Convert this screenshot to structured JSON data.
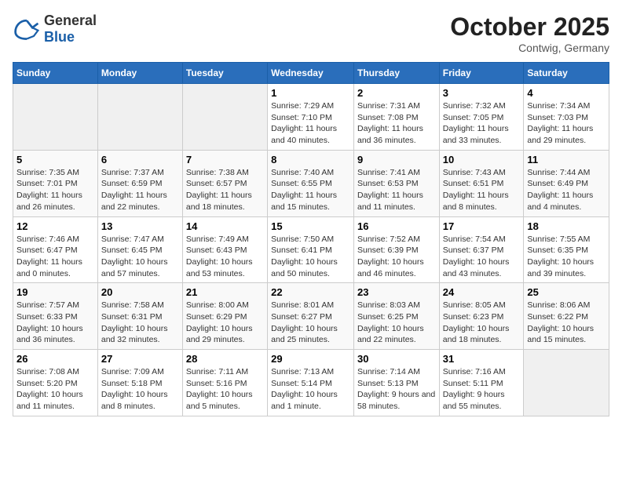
{
  "header": {
    "logo_general": "General",
    "logo_blue": "Blue",
    "month_title": "October 2025",
    "location": "Contwig, Germany"
  },
  "days_of_week": [
    "Sunday",
    "Monday",
    "Tuesday",
    "Wednesday",
    "Thursday",
    "Friday",
    "Saturday"
  ],
  "weeks": [
    [
      {
        "day": "",
        "info": ""
      },
      {
        "day": "",
        "info": ""
      },
      {
        "day": "",
        "info": ""
      },
      {
        "day": "1",
        "info": "Sunrise: 7:29 AM\nSunset: 7:10 PM\nDaylight: 11 hours and 40 minutes."
      },
      {
        "day": "2",
        "info": "Sunrise: 7:31 AM\nSunset: 7:08 PM\nDaylight: 11 hours and 36 minutes."
      },
      {
        "day": "3",
        "info": "Sunrise: 7:32 AM\nSunset: 7:05 PM\nDaylight: 11 hours and 33 minutes."
      },
      {
        "day": "4",
        "info": "Sunrise: 7:34 AM\nSunset: 7:03 PM\nDaylight: 11 hours and 29 minutes."
      }
    ],
    [
      {
        "day": "5",
        "info": "Sunrise: 7:35 AM\nSunset: 7:01 PM\nDaylight: 11 hours and 26 minutes."
      },
      {
        "day": "6",
        "info": "Sunrise: 7:37 AM\nSunset: 6:59 PM\nDaylight: 11 hours and 22 minutes."
      },
      {
        "day": "7",
        "info": "Sunrise: 7:38 AM\nSunset: 6:57 PM\nDaylight: 11 hours and 18 minutes."
      },
      {
        "day": "8",
        "info": "Sunrise: 7:40 AM\nSunset: 6:55 PM\nDaylight: 11 hours and 15 minutes."
      },
      {
        "day": "9",
        "info": "Sunrise: 7:41 AM\nSunset: 6:53 PM\nDaylight: 11 hours and 11 minutes."
      },
      {
        "day": "10",
        "info": "Sunrise: 7:43 AM\nSunset: 6:51 PM\nDaylight: 11 hours and 8 minutes."
      },
      {
        "day": "11",
        "info": "Sunrise: 7:44 AM\nSunset: 6:49 PM\nDaylight: 11 hours and 4 minutes."
      }
    ],
    [
      {
        "day": "12",
        "info": "Sunrise: 7:46 AM\nSunset: 6:47 PM\nDaylight: 11 hours and 0 minutes."
      },
      {
        "day": "13",
        "info": "Sunrise: 7:47 AM\nSunset: 6:45 PM\nDaylight: 10 hours and 57 minutes."
      },
      {
        "day": "14",
        "info": "Sunrise: 7:49 AM\nSunset: 6:43 PM\nDaylight: 10 hours and 53 minutes."
      },
      {
        "day": "15",
        "info": "Sunrise: 7:50 AM\nSunset: 6:41 PM\nDaylight: 10 hours and 50 minutes."
      },
      {
        "day": "16",
        "info": "Sunrise: 7:52 AM\nSunset: 6:39 PM\nDaylight: 10 hours and 46 minutes."
      },
      {
        "day": "17",
        "info": "Sunrise: 7:54 AM\nSunset: 6:37 PM\nDaylight: 10 hours and 43 minutes."
      },
      {
        "day": "18",
        "info": "Sunrise: 7:55 AM\nSunset: 6:35 PM\nDaylight: 10 hours and 39 minutes."
      }
    ],
    [
      {
        "day": "19",
        "info": "Sunrise: 7:57 AM\nSunset: 6:33 PM\nDaylight: 10 hours and 36 minutes."
      },
      {
        "day": "20",
        "info": "Sunrise: 7:58 AM\nSunset: 6:31 PM\nDaylight: 10 hours and 32 minutes."
      },
      {
        "day": "21",
        "info": "Sunrise: 8:00 AM\nSunset: 6:29 PM\nDaylight: 10 hours and 29 minutes."
      },
      {
        "day": "22",
        "info": "Sunrise: 8:01 AM\nSunset: 6:27 PM\nDaylight: 10 hours and 25 minutes."
      },
      {
        "day": "23",
        "info": "Sunrise: 8:03 AM\nSunset: 6:25 PM\nDaylight: 10 hours and 22 minutes."
      },
      {
        "day": "24",
        "info": "Sunrise: 8:05 AM\nSunset: 6:23 PM\nDaylight: 10 hours and 18 minutes."
      },
      {
        "day": "25",
        "info": "Sunrise: 8:06 AM\nSunset: 6:22 PM\nDaylight: 10 hours and 15 minutes."
      }
    ],
    [
      {
        "day": "26",
        "info": "Sunrise: 7:08 AM\nSunset: 5:20 PM\nDaylight: 10 hours and 11 minutes."
      },
      {
        "day": "27",
        "info": "Sunrise: 7:09 AM\nSunset: 5:18 PM\nDaylight: 10 hours and 8 minutes."
      },
      {
        "day": "28",
        "info": "Sunrise: 7:11 AM\nSunset: 5:16 PM\nDaylight: 10 hours and 5 minutes."
      },
      {
        "day": "29",
        "info": "Sunrise: 7:13 AM\nSunset: 5:14 PM\nDaylight: 10 hours and 1 minute."
      },
      {
        "day": "30",
        "info": "Sunrise: 7:14 AM\nSunset: 5:13 PM\nDaylight: 9 hours and 58 minutes."
      },
      {
        "day": "31",
        "info": "Sunrise: 7:16 AM\nSunset: 5:11 PM\nDaylight: 9 hours and 55 minutes."
      },
      {
        "day": "",
        "info": ""
      }
    ]
  ]
}
